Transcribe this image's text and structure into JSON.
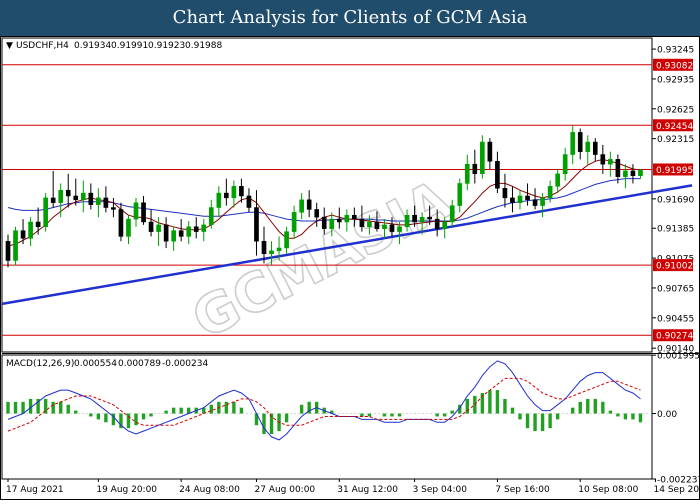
{
  "banner": {
    "title": "Chart Analysis for Clients of GCM Asia"
  },
  "watermark": "GCMASIA",
  "colors": {
    "up": "#00a000",
    "down": "#000000",
    "level": "#d00000",
    "trend": "#1f2fd0",
    "ma_fast": "#8b0000",
    "ma_slow": "#2030c0",
    "macd_line": "#1f2fd0",
    "signal_line": "#d00000",
    "hist": "#22a022"
  },
  "chart_data": [
    {
      "type": "candlestick",
      "title": "USDCHF,H4",
      "ohlc_readout": [
        "0.91934",
        "0.91991",
        "0.91923",
        "0.91988"
      ],
      "ylim": [
        0.901,
        0.9336
      ],
      "y_ticks": [
        "0.93245",
        "0.92935",
        "0.92625",
        "0.92315",
        "0.91690",
        "0.91385",
        "0.91075",
        "0.90765",
        "0.90455",
        "0.90140"
      ],
      "levels": [
        {
          "value": 0.93082,
          "label": "0.93082"
        },
        {
          "value": 0.92454,
          "label": "0.92454"
        },
        {
          "value": 0.91995,
          "label": "0.91995"
        },
        {
          "value": 0.91002,
          "label": "0.91002"
        },
        {
          "value": 0.90274,
          "label": "0.90274"
        }
      ],
      "trendline": {
        "from": [
          0,
          0.906
        ],
        "to": [
          88,
          0.9183
        ]
      },
      "x_labels": [
        "17 Aug 2021",
        "19 Aug 20:00",
        "24 Aug 08:00",
        "27 Aug 00:00",
        "31 Aug 12:00",
        "3 Sep 04:00",
        "7 Sep 16:00",
        "10 Sep 08:00",
        "14 Sep 20:00"
      ],
      "x_label_index": [
        0,
        12,
        23,
        33,
        44,
        54,
        65,
        76,
        86
      ],
      "candles": [
        [
          0.9125,
          0.9132,
          0.9098,
          0.9105
        ],
        [
          0.9105,
          0.914,
          0.91,
          0.9136
        ],
        [
          0.9136,
          0.9148,
          0.9122,
          0.9128
        ],
        [
          0.9128,
          0.915,
          0.912,
          0.9145
        ],
        [
          0.9145,
          0.916,
          0.9132,
          0.914
        ],
        [
          0.914,
          0.9175,
          0.9135,
          0.917
        ],
        [
          0.917,
          0.9198,
          0.916,
          0.9165
        ],
        [
          0.9165,
          0.9185,
          0.915,
          0.9178
        ],
        [
          0.9178,
          0.9195,
          0.916,
          0.9172
        ],
        [
          0.9172,
          0.919,
          0.9162,
          0.9168
        ],
        [
          0.9168,
          0.9188,
          0.9155,
          0.9175
        ],
        [
          0.9175,
          0.9185,
          0.9158,
          0.9163
        ],
        [
          0.9163,
          0.918,
          0.915,
          0.917
        ],
        [
          0.917,
          0.9182,
          0.9155,
          0.916
        ],
        [
          0.916,
          0.917,
          0.915,
          0.9158
        ],
        [
          0.9158,
          0.9165,
          0.9125,
          0.913
        ],
        [
          0.913,
          0.9152,
          0.9122,
          0.9148
        ],
        [
          0.9148,
          0.917,
          0.914,
          0.9165
        ],
        [
          0.9165,
          0.9172,
          0.9142,
          0.9145
        ],
        [
          0.9145,
          0.9158,
          0.913,
          0.9135
        ],
        [
          0.9135,
          0.915,
          0.912,
          0.9142
        ],
        [
          0.9142,
          0.915,
          0.9118,
          0.9125
        ],
        [
          0.9125,
          0.914,
          0.9115,
          0.9136
        ],
        [
          0.9136,
          0.9148,
          0.9125,
          0.913
        ],
        [
          0.913,
          0.9146,
          0.9122,
          0.914
        ],
        [
          0.914,
          0.915,
          0.9128,
          0.9135
        ],
        [
          0.9135,
          0.9148,
          0.9125,
          0.9142
        ],
        [
          0.9142,
          0.9168,
          0.9138,
          0.916
        ],
        [
          0.916,
          0.9182,
          0.915,
          0.9175
        ],
        [
          0.9175,
          0.919,
          0.9162,
          0.917
        ],
        [
          0.917,
          0.9188,
          0.916,
          0.9182
        ],
        [
          0.9182,
          0.919,
          0.9165,
          0.9172
        ],
        [
          0.9172,
          0.918,
          0.9155,
          0.916
        ],
        [
          0.916,
          0.9178,
          0.911,
          0.9125
        ],
        [
          0.9125,
          0.914,
          0.9102,
          0.9112
        ],
        [
          0.9112,
          0.9125,
          0.91,
          0.9115
        ],
        [
          0.9115,
          0.913,
          0.9105,
          0.9118
        ],
        [
          0.9118,
          0.914,
          0.9112,
          0.9135
        ],
        [
          0.9135,
          0.9162,
          0.9128,
          0.9155
        ],
        [
          0.9155,
          0.9175,
          0.9148,
          0.9168
        ],
        [
          0.9168,
          0.9178,
          0.915,
          0.9158
        ],
        [
          0.9158,
          0.9165,
          0.914,
          0.915
        ],
        [
          0.915,
          0.916,
          0.9132,
          0.9138
        ],
        [
          0.9138,
          0.9155,
          0.913,
          0.9148
        ],
        [
          0.9148,
          0.916,
          0.9138,
          0.9145
        ],
        [
          0.9145,
          0.9158,
          0.9135,
          0.9152
        ],
        [
          0.9152,
          0.916,
          0.914,
          0.9148
        ],
        [
          0.9148,
          0.9162,
          0.9135,
          0.914
        ],
        [
          0.914,
          0.9152,
          0.9132,
          0.9145
        ],
        [
          0.9145,
          0.9156,
          0.9135,
          0.9138
        ],
        [
          0.9138,
          0.9148,
          0.9128,
          0.9142
        ],
        [
          0.9142,
          0.915,
          0.913,
          0.9135
        ],
        [
          0.9135,
          0.9145,
          0.9122,
          0.914
        ],
        [
          0.914,
          0.9158,
          0.9135,
          0.9152
        ],
        [
          0.9152,
          0.9162,
          0.914,
          0.9145
        ],
        [
          0.9145,
          0.9155,
          0.9132,
          0.915
        ],
        [
          0.915,
          0.9162,
          0.9142,
          0.9148
        ],
        [
          0.9148,
          0.9158,
          0.913,
          0.9138
        ],
        [
          0.9138,
          0.915,
          0.9128,
          0.9145
        ],
        [
          0.9145,
          0.9168,
          0.914,
          0.9162
        ],
        [
          0.9162,
          0.919,
          0.9155,
          0.9185
        ],
        [
          0.9185,
          0.9215,
          0.9178,
          0.9205
        ],
        [
          0.9205,
          0.922,
          0.9185,
          0.9195
        ],
        [
          0.9195,
          0.9235,
          0.919,
          0.9228
        ],
        [
          0.9228,
          0.9232,
          0.92,
          0.9208
        ],
        [
          0.9208,
          0.9218,
          0.9175,
          0.918
        ],
        [
          0.918,
          0.9195,
          0.916,
          0.917
        ],
        [
          0.917,
          0.9182,
          0.9155,
          0.9165
        ],
        [
          0.9165,
          0.9178,
          0.9158,
          0.9172
        ],
        [
          0.9172,
          0.9185,
          0.9162,
          0.9168
        ],
        [
          0.9168,
          0.918,
          0.9158,
          0.9162
        ],
        [
          0.9162,
          0.9175,
          0.915,
          0.917
        ],
        [
          0.917,
          0.9188,
          0.9165,
          0.9182
        ],
        [
          0.9182,
          0.92,
          0.9175,
          0.9195
        ],
        [
          0.9195,
          0.9222,
          0.9188,
          0.9215
        ],
        [
          0.9215,
          0.9245,
          0.9205,
          0.9238
        ],
        [
          0.9238,
          0.9242,
          0.921,
          0.9218
        ],
        [
          0.9218,
          0.9235,
          0.9205,
          0.9228
        ],
        [
          0.9228,
          0.9232,
          0.9208,
          0.9215
        ],
        [
          0.9215,
          0.9225,
          0.9195,
          0.9205
        ],
        [
          0.9205,
          0.9218,
          0.9192,
          0.921
        ],
        [
          0.921,
          0.9215,
          0.9185,
          0.9192
        ],
        [
          0.9192,
          0.9205,
          0.918,
          0.9198
        ],
        [
          0.9198,
          0.9205,
          0.9185,
          0.9193
        ],
        [
          0.9193,
          0.92,
          0.919,
          0.9199
        ]
      ],
      "ma_fast": [
        0.912,
        0.9122,
        0.9126,
        0.913,
        0.9136,
        0.9142,
        0.915,
        0.9156,
        0.9162,
        0.9166,
        0.9168,
        0.917,
        0.9168,
        0.9167,
        0.9165,
        0.9158,
        0.9152,
        0.915,
        0.915,
        0.9148,
        0.9144,
        0.9142,
        0.914,
        0.9138,
        0.9137,
        0.9137,
        0.9138,
        0.9142,
        0.9148,
        0.9155,
        0.9162,
        0.9168,
        0.917,
        0.9165,
        0.9155,
        0.9145,
        0.9135,
        0.9128,
        0.9128,
        0.9132,
        0.914,
        0.9146,
        0.915,
        0.9152,
        0.915,
        0.9148,
        0.9148,
        0.9147,
        0.9146,
        0.9145,
        0.9144,
        0.9143,
        0.9142,
        0.9142,
        0.9143,
        0.9144,
        0.9145,
        0.9146,
        0.9145,
        0.9146,
        0.915,
        0.9158,
        0.9166,
        0.9175,
        0.9182,
        0.9185,
        0.9185,
        0.9182,
        0.9178,
        0.9175,
        0.9172,
        0.917,
        0.9172,
        0.9176,
        0.9182,
        0.919,
        0.9198,
        0.9204,
        0.9208,
        0.921,
        0.9208,
        0.9206,
        0.9203,
        0.92,
        0.9199
      ],
      "ma_slow": [
        0.916,
        0.9158,
        0.9157,
        0.9157,
        0.9157,
        0.9158,
        0.916,
        0.9162,
        0.9164,
        0.9165,
        0.9166,
        0.9166,
        0.9166,
        0.9166,
        0.9165,
        0.9163,
        0.9161,
        0.916,
        0.9159,
        0.9158,
        0.9157,
        0.9156,
        0.9155,
        0.9154,
        0.9153,
        0.9152,
        0.9151,
        0.9151,
        0.9151,
        0.9152,
        0.9153,
        0.9154,
        0.9155,
        0.9155,
        0.9154,
        0.9152,
        0.915,
        0.9148,
        0.9147,
        0.9146,
        0.9146,
        0.9146,
        0.9147,
        0.9147,
        0.9148,
        0.9148,
        0.9148,
        0.9148,
        0.9148,
        0.9147,
        0.9147,
        0.9146,
        0.9146,
        0.9146,
        0.9146,
        0.9146,
        0.9146,
        0.9146,
        0.9146,
        0.9146,
        0.9147,
        0.9149,
        0.9152,
        0.9155,
        0.9158,
        0.9161,
        0.9163,
        0.9165,
        0.9166,
        0.9167,
        0.9168,
        0.9168,
        0.9169,
        0.917,
        0.9172,
        0.9175,
        0.9178,
        0.9181,
        0.9184,
        0.9186,
        0.9188,
        0.9189,
        0.919,
        0.919,
        0.919
      ]
    },
    {
      "type": "macd",
      "title": "MACD(12,26,9)",
      "readout": [
        "0.000554",
        "0.000789",
        "-0.000234"
      ],
      "ylim": [
        -0.002237,
        0.002
      ],
      "y_ticks": [
        "0.001995",
        "0.00",
        "-0.002237"
      ],
      "macd": [
        -0.0002,
        -0.0001,
        0.0,
        0.0002,
        0.0004,
        0.0006,
        0.0007,
        0.0008,
        0.0008,
        0.0007,
        0.0006,
        0.0005,
        0.0003,
        0.0001,
        -0.0001,
        -0.0004,
        -0.0006,
        -0.0007,
        -0.0006,
        -0.0005,
        -0.0004,
        -0.0003,
        -0.0002,
        -0.0001,
        0.0,
        0.0001,
        0.0002,
        0.0004,
        0.0006,
        0.0007,
        0.0008,
        0.0007,
        0.0005,
        0.0,
        -0.0005,
        -0.0008,
        -0.0009,
        -0.0007,
        -0.0004,
        -0.0001,
        0.0001,
        0.0002,
        0.0001,
        0.0,
        -0.0001,
        -0.0001,
        -0.0001,
        -0.0002,
        -0.0002,
        -0.0002,
        -0.0003,
        -0.0003,
        -0.0003,
        -0.0002,
        -0.0002,
        -0.0002,
        -0.0002,
        -0.0003,
        -0.0003,
        -0.0001,
        0.0002,
        0.0006,
        0.0009,
        0.0013,
        0.0016,
        0.0018,
        0.0017,
        0.0014,
        0.001,
        0.0006,
        0.0003,
        0.0001,
        0.0001,
        0.0003,
        0.0005,
        0.0008,
        0.0011,
        0.0013,
        0.0014,
        0.0014,
        0.0012,
        0.001,
        0.0008,
        0.0007,
        0.0005
      ],
      "signal": [
        -0.0006,
        -0.0005,
        -0.0004,
        -0.0003,
        -0.0001,
        0.0001,
        0.0003,
        0.0004,
        0.0005,
        0.0006,
        0.0006,
        0.0006,
        0.0005,
        0.0004,
        0.0003,
        0.0001,
        -0.0001,
        -0.0003,
        -0.0004,
        -0.0004,
        -0.0004,
        -0.0004,
        -0.0004,
        -0.0003,
        -0.0002,
        -0.0001,
        0.0,
        0.0001,
        0.0002,
        0.0003,
        0.0004,
        0.0005,
        0.0005,
        0.0004,
        0.0002,
        -0.0001,
        -0.0003,
        -0.0004,
        -0.0004,
        -0.0004,
        -0.0003,
        -0.0002,
        -0.0001,
        -0.0001,
        -0.0001,
        -0.0001,
        -0.0001,
        -0.0001,
        -0.0001,
        -0.0002,
        -0.0002,
        -0.0002,
        -0.0002,
        -0.0002,
        -0.0002,
        -0.0002,
        -0.0002,
        -0.0002,
        -0.0002,
        -0.0002,
        -0.0001,
        0.0001,
        0.0003,
        0.0006,
        0.0008,
        0.001,
        0.0012,
        0.0012,
        0.0012,
        0.0011,
        0.0009,
        0.0007,
        0.0006,
        0.0005,
        0.0005,
        0.0006,
        0.0007,
        0.0008,
        0.0009,
        0.001,
        0.0011,
        0.0011,
        0.001,
        0.0009,
        0.0008
      ]
    }
  ]
}
